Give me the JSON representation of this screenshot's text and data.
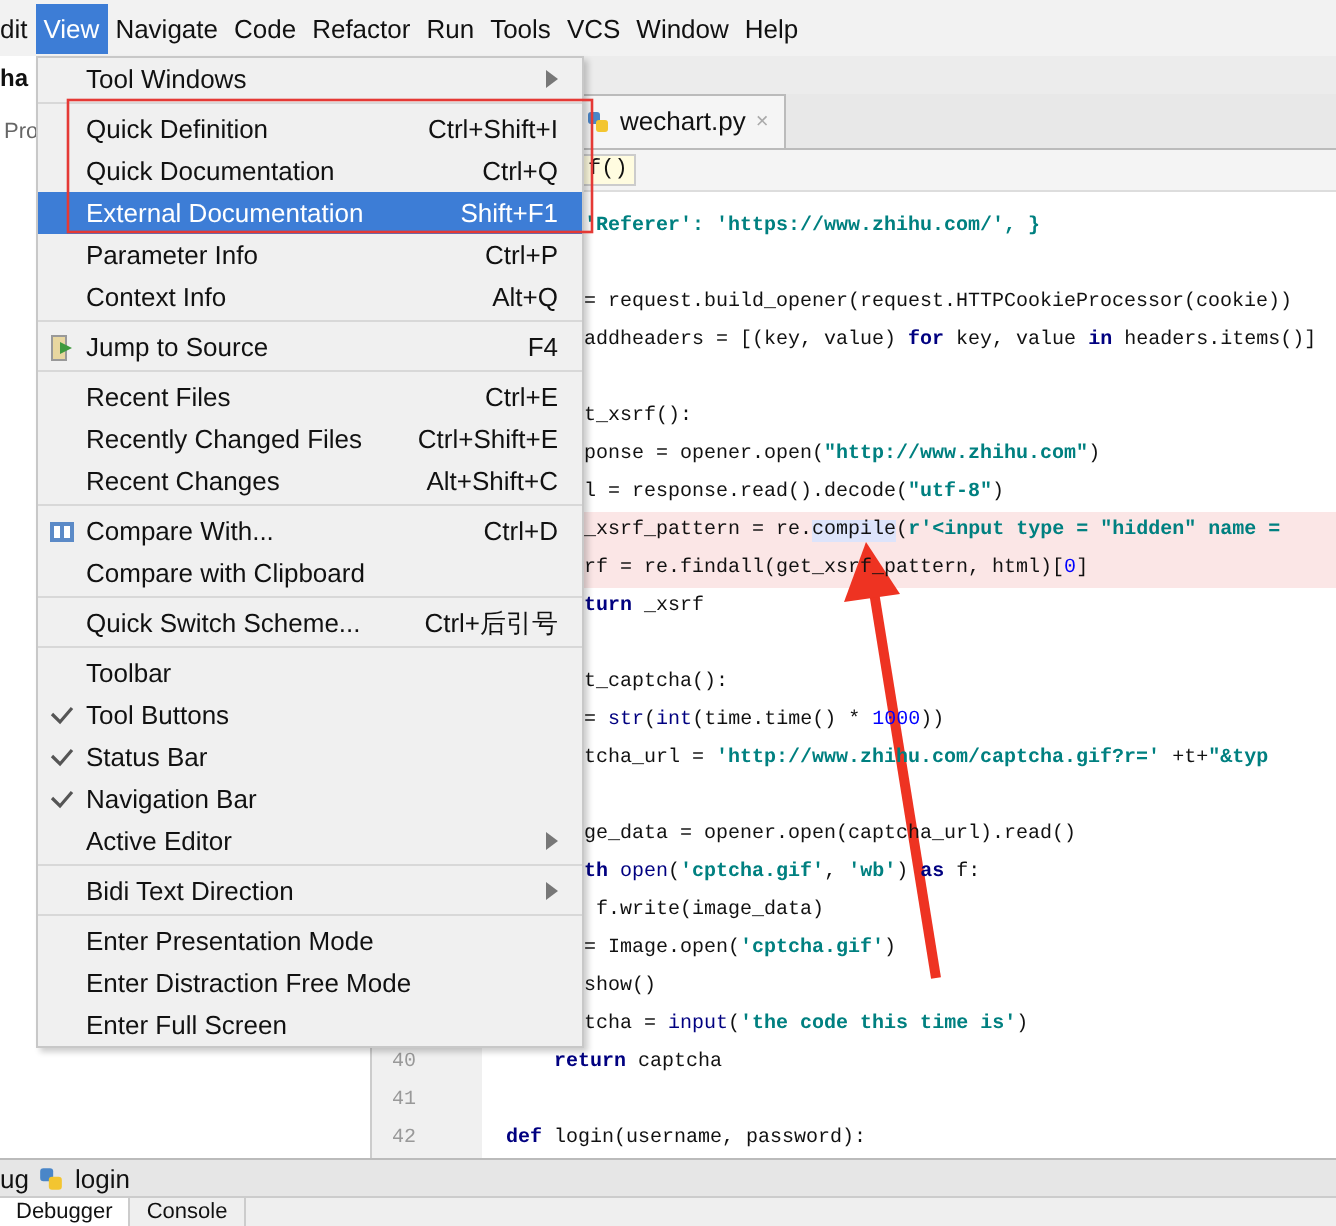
{
  "menubar": [
    {
      "label": "dit",
      "selected": false
    },
    {
      "label": "View",
      "selected": true
    },
    {
      "label": "Navigate",
      "selected": false
    },
    {
      "label": "Code",
      "selected": false
    },
    {
      "label": "Refactor",
      "selected": false
    },
    {
      "label": "Run",
      "selected": false
    },
    {
      "label": "Tools",
      "selected": false
    },
    {
      "label": "VCS",
      "selected": false
    },
    {
      "label": "Window",
      "selected": false
    },
    {
      "label": "Help",
      "selected": false
    }
  ],
  "side_panel": {
    "title": "ha",
    "tab": "Pro"
  },
  "editor_tab": {
    "label": "wechart.py",
    "close": "×"
  },
  "breadcrumb": "f()",
  "code_lines": [
    {
      "highlighted": false,
      "tokens": [
        {
          "kind": "str",
          "text": "'Referer': 'https://www.zhihu.com/', }"
        }
      ]
    },
    {
      "highlighted": false
    },
    {
      "highlighted": false,
      "tokens": [
        {
          "kind": "plain",
          "text": "= request.build_opener(request.HTTPCookieProcessor(cookie))"
        }
      ]
    },
    {
      "highlighted": false,
      "tokens": [
        {
          "kind": "plain",
          "text": "addheaders = [(key, value) "
        },
        {
          "kind": "kw",
          "text": "for"
        },
        {
          "kind": "plain",
          "text": " key, value "
        },
        {
          "kind": "kw",
          "text": "in"
        },
        {
          "kind": "plain",
          "text": " headers.items()]"
        }
      ]
    },
    {
      "highlighted": false
    },
    {
      "highlighted": false,
      "tokens": [
        {
          "kind": "plain",
          "text": "t_xsrf():"
        }
      ]
    },
    {
      "highlighted": false,
      "tokens": [
        {
          "kind": "plain",
          "text": "ponse = opener.open("
        },
        {
          "kind": "str",
          "text": "\"http://www.zhihu.com\""
        },
        {
          "kind": "plain",
          "text": ")"
        }
      ]
    },
    {
      "highlighted": false,
      "tokens": [
        {
          "kind": "plain",
          "text": "l = response.read().decode("
        },
        {
          "kind": "str",
          "text": "\"utf-8\""
        },
        {
          "kind": "plain",
          "text": ")"
        }
      ]
    },
    {
      "highlighted": true,
      "tokens": [
        {
          "kind": "plain",
          "text": "_xsrf_pattern = re."
        },
        {
          "kind": "mark",
          "text": "compile"
        },
        {
          "kind": "plain",
          "text": "("
        },
        {
          "kind": "str",
          "text": "r'<input type = \"hidden\" name ="
        }
      ]
    },
    {
      "highlighted": true,
      "tokens": [
        {
          "kind": "plain",
          "text": "rf = re.findall(get_xsrf_pattern, html)["
        },
        {
          "kind": "num",
          "text": "0"
        },
        {
          "kind": "plain",
          "text": "]"
        }
      ]
    },
    {
      "highlighted": false,
      "tokens": [
        {
          "kind": "kw",
          "text": "turn"
        },
        {
          "kind": "plain",
          "text": " _xsrf"
        }
      ]
    },
    {
      "highlighted": false
    },
    {
      "highlighted": false,
      "tokens": [
        {
          "kind": "plain",
          "text": "t_captcha():"
        }
      ]
    },
    {
      "highlighted": false,
      "tokens": [
        {
          "kind": "plain",
          "text": "= "
        },
        {
          "kind": "fn",
          "text": "str"
        },
        {
          "kind": "plain",
          "text": "("
        },
        {
          "kind": "fn",
          "text": "int"
        },
        {
          "kind": "plain",
          "text": "(time.time() * "
        },
        {
          "kind": "num",
          "text": "1000"
        },
        {
          "kind": "plain",
          "text": "))"
        }
      ]
    },
    {
      "highlighted": false,
      "tokens": [
        {
          "kind": "plain",
          "text": "tcha_url = "
        },
        {
          "kind": "str",
          "text": "'http://www.zhihu.com/captcha.gif?r='"
        },
        {
          "kind": "plain",
          "text": " +t+"
        },
        {
          "kind": "str",
          "text": "\"&typ"
        }
      ]
    },
    {
      "highlighted": false
    },
    {
      "highlighted": false,
      "tokens": [
        {
          "kind": "plain",
          "text": "ge_data = opener.open(captcha_url).read()"
        }
      ]
    },
    {
      "highlighted": false,
      "tokens": [
        {
          "kind": "kw",
          "text": "th"
        },
        {
          "kind": "fn",
          "text": " open"
        },
        {
          "kind": "plain",
          "text": "("
        },
        {
          "kind": "str",
          "text": "'cptcha.gif'"
        },
        {
          "kind": "plain",
          "text": ", "
        },
        {
          "kind": "str",
          "text": "'wb'"
        },
        {
          "kind": "plain",
          "text": ") "
        },
        {
          "kind": "kw",
          "text": "as"
        },
        {
          "kind": "plain",
          "text": " f:"
        }
      ]
    },
    {
      "highlighted": false,
      "tokens": [
        {
          "kind": "plain",
          "text": " f.write(image_data)"
        }
      ]
    },
    {
      "highlighted": false,
      "tokens": [
        {
          "kind": "plain",
          "text": "= Image.open("
        },
        {
          "kind": "str",
          "text": "'cptcha.gif'"
        },
        {
          "kind": "plain",
          "text": ")"
        }
      ]
    },
    {
      "highlighted": false,
      "tokens": [
        {
          "kind": "plain",
          "text": "show()"
        }
      ]
    },
    {
      "highlighted": false,
      "tokens": [
        {
          "kind": "plain",
          "text": "tcha = "
        },
        {
          "kind": "fn",
          "text": "input"
        },
        {
          "kind": "plain",
          "text": "("
        },
        {
          "kind": "str",
          "text": "'the code this time is'"
        },
        {
          "kind": "plain",
          "text": ")"
        }
      ]
    },
    {
      "number": "40",
      "highlighted": false,
      "tokens": [
        {
          "kind": "kw",
          "text": "    return"
        },
        {
          "kind": "plain",
          "text": " captcha"
        }
      ]
    },
    {
      "number": "41",
      "highlighted": false
    },
    {
      "number": "42",
      "highlighted": false,
      "tokens": [
        {
          "kind": "kw",
          "text": "def"
        },
        {
          "kind": "plain",
          "text": " login(username, password):"
        }
      ]
    }
  ],
  "debug_bar": {
    "prefix": "ug",
    "config": "login"
  },
  "bottom_tabs": [
    {
      "label": "Debugger",
      "selected": true
    },
    {
      "label": "Console",
      "selected": false
    }
  ],
  "menu_groups": [
    [
      {
        "label": "Tool Windows",
        "submenu": true,
        "checked": false,
        "selected": false
      }
    ],
    [
      {
        "label": "Quick Definition",
        "shortcut": "Ctrl+Shift+I",
        "submenu": false,
        "checked": false,
        "selected": false
      },
      {
        "label": "Quick Documentation",
        "shortcut": "Ctrl+Q",
        "submenu": false,
        "checked": false,
        "selected": false
      },
      {
        "label": "External Documentation",
        "shortcut": "Shift+F1",
        "submenu": false,
        "checked": false,
        "selected": true
      },
      {
        "label": "Parameter Info",
        "shortcut": "Ctrl+P",
        "submenu": false,
        "checked": false,
        "selected": false
      },
      {
        "label": "Context Info",
        "shortcut": "Alt+Q",
        "submenu": false,
        "checked": false,
        "selected": false
      }
    ],
    [
      {
        "label": "Jump to Source",
        "shortcut": "F4",
        "submenu": false,
        "checked": false,
        "selected": false
      }
    ],
    [
      {
        "label": "Recent Files",
        "shortcut": "Ctrl+E",
        "submenu": false,
        "checked": false,
        "selected": false
      },
      {
        "label": "Recently Changed Files",
        "shortcut": "Ctrl+Shift+E",
        "submenu": false,
        "checked": false,
        "selected": false
      },
      {
        "label": "Recent Changes",
        "shortcut": "Alt+Shift+C",
        "submenu": false,
        "checked": false,
        "selected": false
      }
    ],
    [
      {
        "label": "Compare With...",
        "shortcut": "Ctrl+D",
        "submenu": false,
        "checked": false,
        "selected": false
      },
      {
        "label": "Compare with Clipboard",
        "submenu": false,
        "checked": false,
        "selected": false
      }
    ],
    [
      {
        "label": "Quick Switch Scheme...",
        "shortcut": "Ctrl+后引号",
        "submenu": false,
        "checked": false,
        "selected": false
      }
    ],
    [
      {
        "label": "Toolbar",
        "submenu": false,
        "checked": false,
        "selected": false
      },
      {
        "label": "Tool Buttons",
        "submenu": false,
        "checked": true,
        "selected": false
      },
      {
        "label": "Status Bar",
        "submenu": false,
        "checked": true,
        "selected": false
      },
      {
        "label": "Navigation Bar",
        "submenu": false,
        "checked": true,
        "selected": false
      },
      {
        "label": "Active Editor",
        "submenu": true,
        "checked": false,
        "selected": false
      }
    ],
    [
      {
        "label": "Bidi Text Direction",
        "submenu": true,
        "checked": false,
        "selected": false
      }
    ],
    [
      {
        "label": "Enter Presentation Mode",
        "submenu": false,
        "checked": false,
        "selected": false
      },
      {
        "label": "Enter Distraction Free Mode",
        "submenu": false,
        "checked": false,
        "selected": false
      },
      {
        "label": "Enter Full Screen",
        "submenu": false,
        "checked": false,
        "selected": false
      }
    ]
  ]
}
